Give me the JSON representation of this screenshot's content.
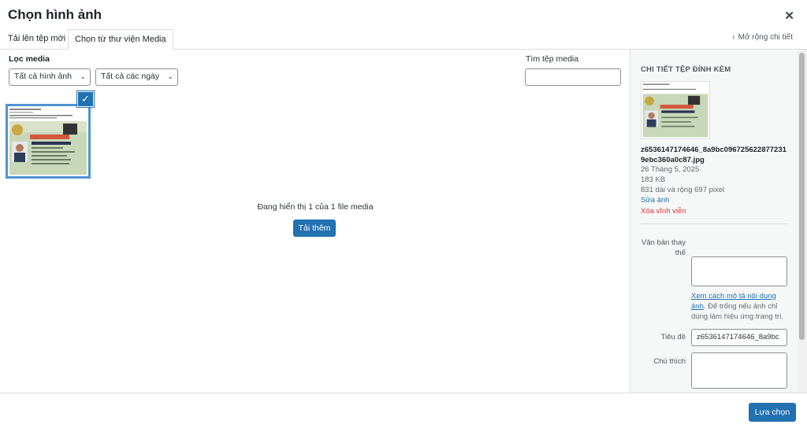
{
  "dialog": {
    "title": "Chọn hình ảnh",
    "close_icon": "close-icon"
  },
  "tabs": [
    {
      "label": "Tải lên tệp mới"
    },
    {
      "label": "Chọn từ thư viện Media",
      "active": true
    }
  ],
  "expand": {
    "label": "Mở rộng chi tiết",
    "icon": "chevron-left-icon"
  },
  "filters": {
    "label": "Lọc media",
    "type_selected": "Tất cả hình ảnh",
    "date_selected": "Tất cả các ngày"
  },
  "search": {
    "label": "Tìm tệp media",
    "value": ""
  },
  "library": {
    "selected_count": 1,
    "status_text": "Đang hiển thị 1 của 1 file media",
    "load_more_label": "Tải thêm"
  },
  "details": {
    "heading": "CHI TIẾT TỆP ĐÍNH KÈM",
    "filename": "z6536147174646_8a9bc0967256228772319ebc360a0c87.jpg",
    "date": "26 Tháng 5, 2025",
    "size": "183 KB",
    "dimensions": "831 dài và rộng 697 pixel",
    "edit_label": "Sửa ảnh",
    "delete_label": "Xóa vĩnh viễn",
    "alt_label": "Văn bản thay thế",
    "alt_value": "",
    "help_link": "Xem cách mô tả nội dung ảnh",
    "help_text": ". Để trống nếu ảnh chỉ dùng làm hiệu ứng trang trí.",
    "title_label": "Tiêu đề",
    "title_value": "z6536147174646_8a9bc",
    "caption_label": "Chú thích",
    "caption_value": ""
  },
  "footer": {
    "select_label": "Lựa chọn"
  },
  "colors": {
    "accent": "#2271b1",
    "danger": "#d63638",
    "sidebar_bg": "#f6f7f7"
  }
}
